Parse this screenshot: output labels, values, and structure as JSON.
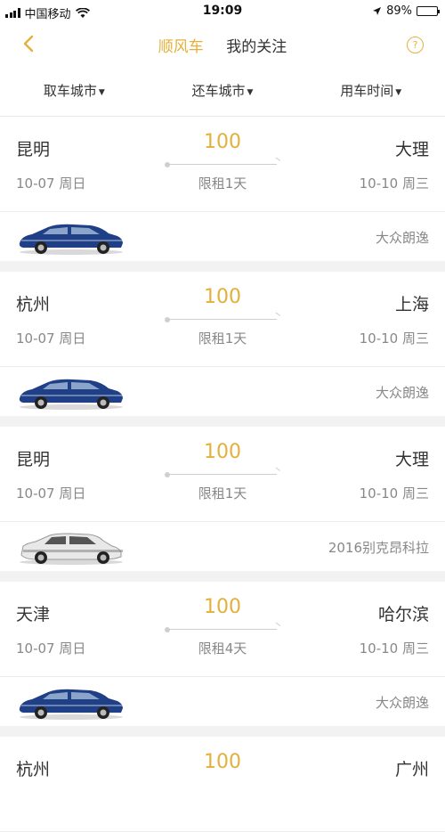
{
  "status": {
    "carrier": "中国移动",
    "time": "19:09",
    "battery": "89%",
    "battery_level": 0.89
  },
  "nav": {
    "tab_active": "顺风车",
    "tab_other": "我的关注",
    "help": "?"
  },
  "filters": [
    {
      "label": "取车城市"
    },
    {
      "label": "还车城市"
    },
    {
      "label": "用车时间"
    }
  ],
  "listings": [
    {
      "from": "昆明",
      "to": "大理",
      "price": "100",
      "from_date": "10-07 周日",
      "to_date": "10-10 周三",
      "days": "限租1天",
      "car": "大众朗逸",
      "car_color": "#1f3f86"
    },
    {
      "from": "杭州",
      "to": "上海",
      "price": "100",
      "from_date": "10-07 周日",
      "to_date": "10-10 周三",
      "days": "限租1天",
      "car": "大众朗逸",
      "car_color": "#1f3f86"
    },
    {
      "from": "昆明",
      "to": "大理",
      "price": "100",
      "from_date": "10-07 周日",
      "to_date": "10-10 周三",
      "days": "限租1天",
      "car": "2016别克昂科拉",
      "car_color": "#e8e8e8"
    },
    {
      "from": "天津",
      "to": "哈尔滨",
      "price": "100",
      "from_date": "10-07 周日",
      "to_date": "10-10 周三",
      "days": "限租4天",
      "car": "大众朗逸",
      "car_color": "#1f3f86"
    },
    {
      "from": "杭州",
      "to": "广州",
      "price": "100"
    }
  ]
}
